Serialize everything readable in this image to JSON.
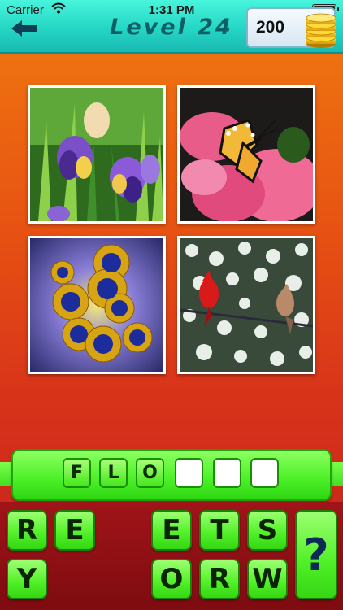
{
  "status_bar": {
    "carrier": "Carrier",
    "time": "1:31 PM"
  },
  "header": {
    "title": "Level 24",
    "back_icon": "back-arrow-icon",
    "coins": "200",
    "coin_icon": "gold-coins-icon"
  },
  "pictures": [
    {
      "name": "iris-flowers"
    },
    {
      "name": "butterfly-on-pink-flower"
    },
    {
      "name": "blue-sunflowers"
    },
    {
      "name": "cardinal-birds-on-branch"
    }
  ],
  "answer": {
    "slots": [
      "F",
      "L",
      "O",
      "",
      "",
      ""
    ]
  },
  "keyboard": {
    "keys": [
      "R",
      "E",
      "E",
      "T",
      "S",
      "Y",
      "O",
      "R",
      "W"
    ],
    "hint_label": "?"
  },
  "colors": {
    "header_teal": "#25d6c5",
    "background_orange": "#f07a10",
    "background_red": "#c0201c",
    "tile_green": "#4ff026",
    "keyboard_bg": "#8e1014",
    "hint_blue": "#0d2a55"
  }
}
